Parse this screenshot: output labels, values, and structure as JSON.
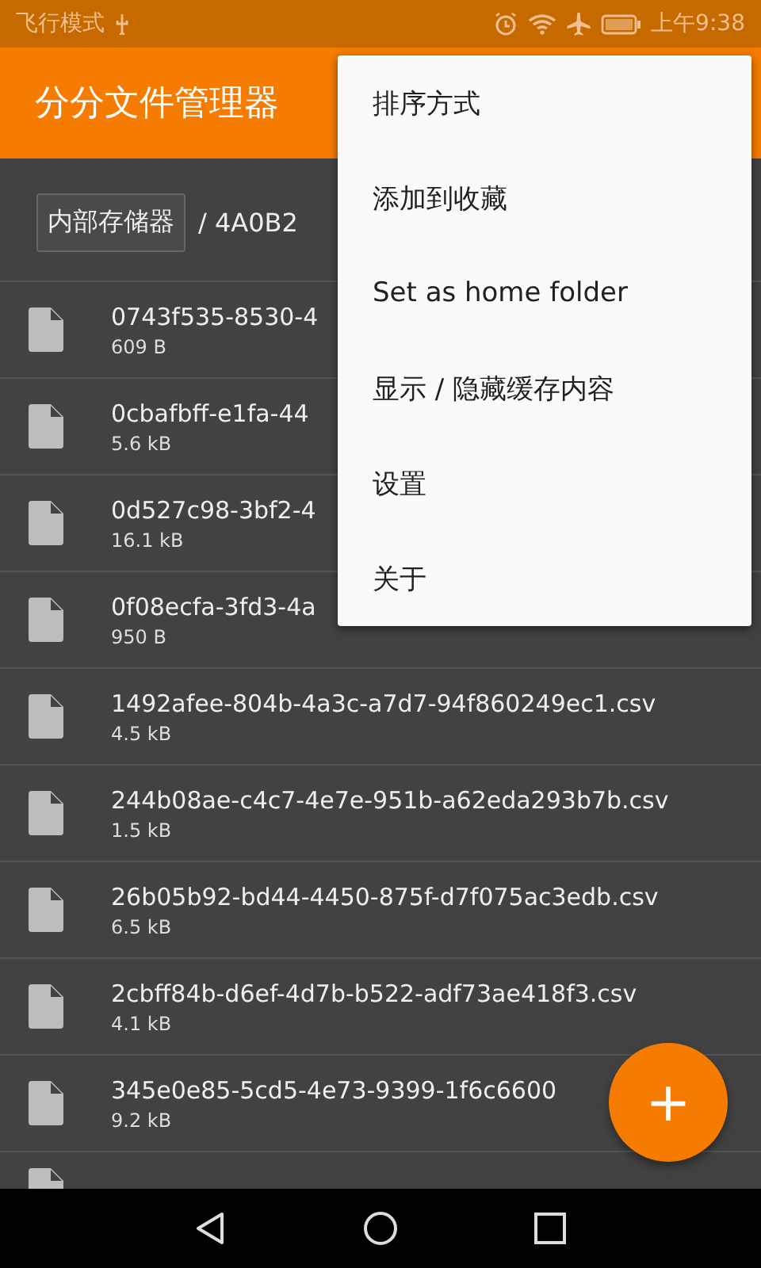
{
  "status_bar": {
    "carrier": "飞行模式",
    "time": "上午9:38"
  },
  "app_bar": {
    "title": "分分文件管理器"
  },
  "breadcrumb": {
    "root": "内部存储器",
    "path": "/ 4A0B2"
  },
  "files": [
    {
      "name": "0743f535-8530-4",
      "size": "609 B"
    },
    {
      "name": "0cbafbff-e1fa-44",
      "size": "5.6 kB"
    },
    {
      "name": "0d527c98-3bf2-4",
      "size": "16.1 kB"
    },
    {
      "name": "0f08ecfa-3fd3-4a",
      "size": "950 B"
    },
    {
      "name": "1492afee-804b-4a3c-a7d7-94f860249ec1.csv",
      "size": "4.5 kB"
    },
    {
      "name": "244b08ae-c4c7-4e7e-951b-a62eda293b7b.csv",
      "size": "1.5 kB"
    },
    {
      "name": "26b05b92-bd44-4450-875f-d7f075ac3edb.csv",
      "size": "6.5 kB"
    },
    {
      "name": "2cbff84b-d6ef-4d7b-b522-adf73ae418f3.csv",
      "size": "4.1 kB"
    },
    {
      "name": "345e0e85-5cd5-4e73-9399-1f6c6600",
      "size": "9.2 kB"
    }
  ],
  "menu": {
    "items": [
      "排序方式",
      "添加到收藏",
      "Set as home folder",
      "显示 / 隐藏缓存内容",
      "设置",
      "关于"
    ]
  },
  "fab": {
    "label": "+"
  }
}
